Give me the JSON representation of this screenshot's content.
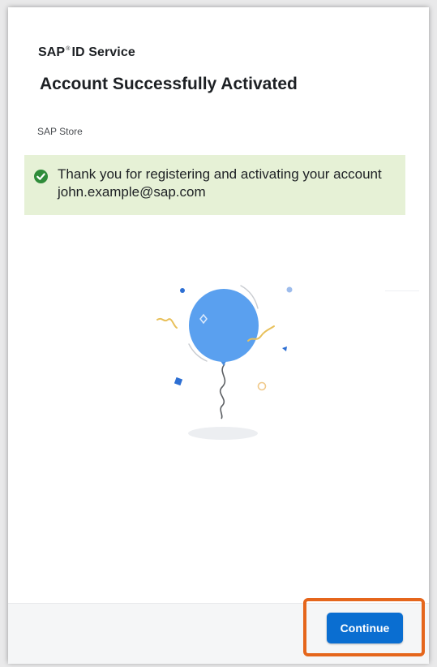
{
  "header": {
    "service_prefix": "SAP",
    "service_mark": "®",
    "service_suffix": "ID Service",
    "title": "Account Successfully Activated",
    "store_name": "SAP Store"
  },
  "alert": {
    "status": "success",
    "icon": "success-check-icon",
    "message": "Thank you for registering and activating your account john.example@sap.com"
  },
  "illustration": {
    "name": "balloon-celebration-illustration"
  },
  "footer": {
    "continue_label": "Continue"
  },
  "colors": {
    "primary_button": "#0a6ed1",
    "success_background": "#e6f1d6",
    "success_icon": "#2f8c3a",
    "balloon": "#5aa0ef",
    "highlight_border": "#e5661c",
    "text": "#1d2024"
  }
}
